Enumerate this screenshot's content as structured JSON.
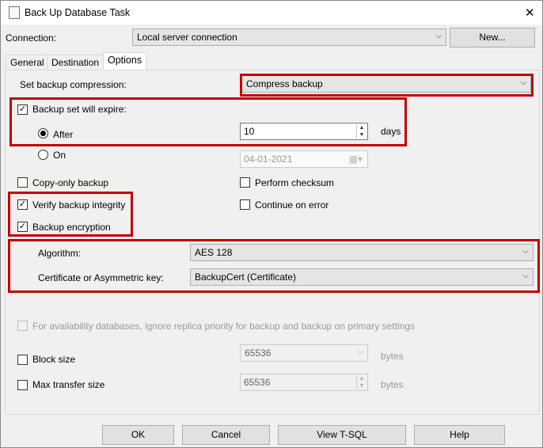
{
  "window": {
    "title": "Back Up Database Task",
    "close": "✕"
  },
  "connection": {
    "label": "Connection:",
    "value": "Local server connection",
    "new_button": "New..."
  },
  "tabs": [
    "General",
    "Destination",
    "Options"
  ],
  "options": {
    "compression_label": "Set backup compression:",
    "compression_value": "Compress backup",
    "expire_label": "Backup set will expire:",
    "expire_checked": true,
    "after_label": "After",
    "after_value": "10",
    "days_label": "days",
    "on_label": "On",
    "on_value": "04-01-2021",
    "copy_only": "Copy-only backup",
    "perform_checksum": "Perform checksum",
    "verify": "Verify backup integrity",
    "continue_on_error": "Continue on error",
    "encryption": "Backup encryption",
    "algorithm_label": "Algorithm:",
    "algorithm_value": "AES 128",
    "cert_label": "Certificate or Asymmetric key:",
    "cert_value": "BackupCert (Certificate)",
    "availability": "For availability databases, ignore replica priority for backup and backup on primary settings",
    "block_size_label": "Block size",
    "block_size_value": "65536",
    "bytes1": "bytes",
    "max_transfer_label": "Max transfer size",
    "max_transfer_value": "65536",
    "bytes2": "bytes"
  },
  "buttons": {
    "ok": "OK",
    "cancel": "Cancel",
    "view_tsql": "View T-SQL",
    "help": "Help"
  },
  "checkmark": "✓",
  "colors": {
    "highlight": "#c00000"
  }
}
